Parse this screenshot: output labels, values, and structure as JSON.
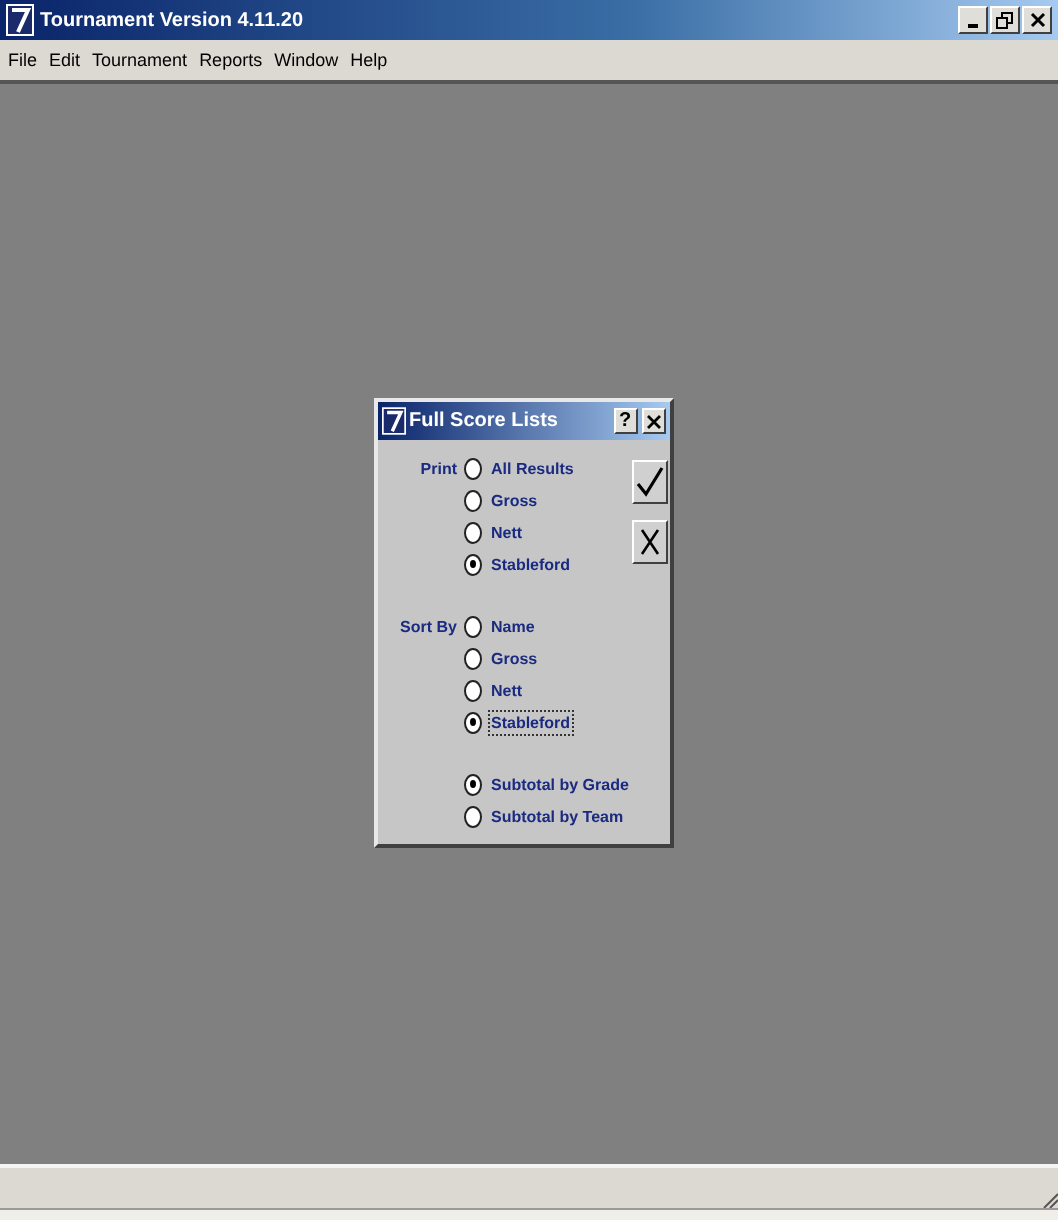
{
  "window": {
    "title": "Tournament Version 4.11.20"
  },
  "menu": [
    "File",
    "Edit",
    "Tournament",
    "Reports",
    "Window",
    "Help"
  ],
  "dialog": {
    "title": "Full Score Lists",
    "help": "?",
    "groups": [
      {
        "label": "Print",
        "options": [
          {
            "label": "All Results",
            "selected": false,
            "focused": false
          },
          {
            "label": "Gross",
            "selected": false,
            "focused": false
          },
          {
            "label": "Nett",
            "selected": false,
            "focused": false
          },
          {
            "label": "Stableford",
            "selected": true,
            "focused": false
          }
        ]
      },
      {
        "label": "Sort By",
        "options": [
          {
            "label": "Name",
            "selected": false,
            "focused": false
          },
          {
            "label": "Gross",
            "selected": false,
            "focused": false
          },
          {
            "label": "Nett",
            "selected": false,
            "focused": false
          },
          {
            "label": "Stableford",
            "selected": true,
            "focused": true
          }
        ]
      },
      {
        "options": [
          {
            "label": "Subtotal by Grade",
            "selected": true,
            "focused": false
          },
          {
            "label": "Subtotal by Team",
            "selected": false,
            "focused": false
          }
        ]
      }
    ],
    "buttons": [
      {
        "kind": "ok"
      },
      {
        "kind": "cancel"
      }
    ]
  }
}
